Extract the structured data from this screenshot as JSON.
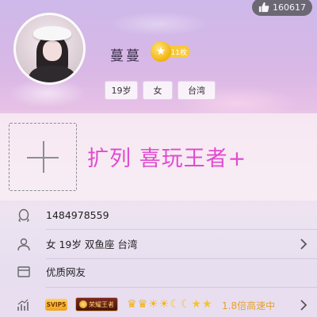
{
  "header": {
    "like_count": "160617",
    "nickname": "蔓蔓",
    "level_label": "11枚"
  },
  "tags": [
    "19岁",
    "女",
    "台湾"
  ],
  "signature": "扩列 喜玩王者+",
  "info_rows": {
    "qq_number": "1484978559",
    "profile": "女  19岁  双鱼座  台湾",
    "friend_type": "优质网友"
  },
  "vip": {
    "vip_label": "SVIP5",
    "game_label": "荣耀王者",
    "level_icons": [
      "crown",
      "crown",
      "sun",
      "sun",
      "moon",
      "moon",
      "star",
      "star"
    ],
    "speed_text": "1.8倍高速中"
  },
  "colors": {
    "signature": "#e04cd0",
    "speed": "#e6a12a",
    "badge_gold": "#f7c93a"
  }
}
